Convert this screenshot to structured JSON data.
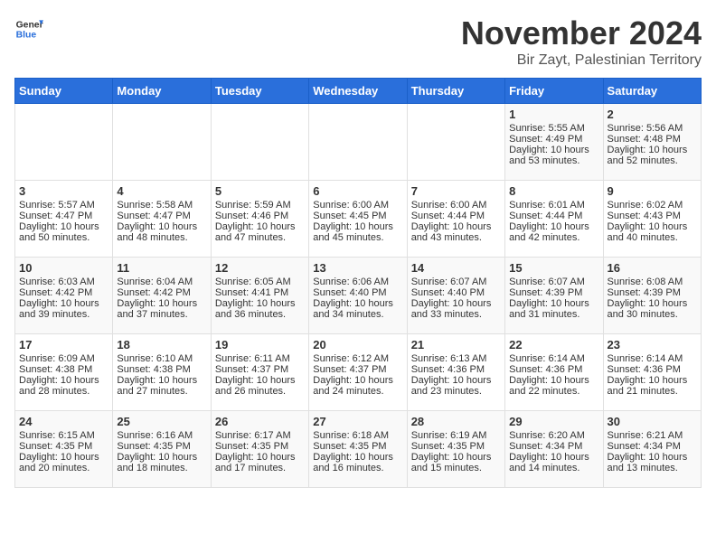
{
  "logo": {
    "general": "General",
    "blue": "Blue"
  },
  "title": "November 2024",
  "subtitle": "Bir Zayt, Palestinian Territory",
  "days_of_week": [
    "Sunday",
    "Monday",
    "Tuesday",
    "Wednesday",
    "Thursday",
    "Friday",
    "Saturday"
  ],
  "weeks": [
    [
      {
        "day": "",
        "content": ""
      },
      {
        "day": "",
        "content": ""
      },
      {
        "day": "",
        "content": ""
      },
      {
        "day": "",
        "content": ""
      },
      {
        "day": "",
        "content": ""
      },
      {
        "day": "1",
        "content": "Sunrise: 5:55 AM\nSunset: 4:49 PM\nDaylight: 10 hours and 53 minutes."
      },
      {
        "day": "2",
        "content": "Sunrise: 5:56 AM\nSunset: 4:48 PM\nDaylight: 10 hours and 52 minutes."
      }
    ],
    [
      {
        "day": "3",
        "content": "Sunrise: 5:57 AM\nSunset: 4:47 PM\nDaylight: 10 hours and 50 minutes."
      },
      {
        "day": "4",
        "content": "Sunrise: 5:58 AM\nSunset: 4:47 PM\nDaylight: 10 hours and 48 minutes."
      },
      {
        "day": "5",
        "content": "Sunrise: 5:59 AM\nSunset: 4:46 PM\nDaylight: 10 hours and 47 minutes."
      },
      {
        "day": "6",
        "content": "Sunrise: 6:00 AM\nSunset: 4:45 PM\nDaylight: 10 hours and 45 minutes."
      },
      {
        "day": "7",
        "content": "Sunrise: 6:00 AM\nSunset: 4:44 PM\nDaylight: 10 hours and 43 minutes."
      },
      {
        "day": "8",
        "content": "Sunrise: 6:01 AM\nSunset: 4:44 PM\nDaylight: 10 hours and 42 minutes."
      },
      {
        "day": "9",
        "content": "Sunrise: 6:02 AM\nSunset: 4:43 PM\nDaylight: 10 hours and 40 minutes."
      }
    ],
    [
      {
        "day": "10",
        "content": "Sunrise: 6:03 AM\nSunset: 4:42 PM\nDaylight: 10 hours and 39 minutes."
      },
      {
        "day": "11",
        "content": "Sunrise: 6:04 AM\nSunset: 4:42 PM\nDaylight: 10 hours and 37 minutes."
      },
      {
        "day": "12",
        "content": "Sunrise: 6:05 AM\nSunset: 4:41 PM\nDaylight: 10 hours and 36 minutes."
      },
      {
        "day": "13",
        "content": "Sunrise: 6:06 AM\nSunset: 4:40 PM\nDaylight: 10 hours and 34 minutes."
      },
      {
        "day": "14",
        "content": "Sunrise: 6:07 AM\nSunset: 4:40 PM\nDaylight: 10 hours and 33 minutes."
      },
      {
        "day": "15",
        "content": "Sunrise: 6:07 AM\nSunset: 4:39 PM\nDaylight: 10 hours and 31 minutes."
      },
      {
        "day": "16",
        "content": "Sunrise: 6:08 AM\nSunset: 4:39 PM\nDaylight: 10 hours and 30 minutes."
      }
    ],
    [
      {
        "day": "17",
        "content": "Sunrise: 6:09 AM\nSunset: 4:38 PM\nDaylight: 10 hours and 28 minutes."
      },
      {
        "day": "18",
        "content": "Sunrise: 6:10 AM\nSunset: 4:38 PM\nDaylight: 10 hours and 27 minutes."
      },
      {
        "day": "19",
        "content": "Sunrise: 6:11 AM\nSunset: 4:37 PM\nDaylight: 10 hours and 26 minutes."
      },
      {
        "day": "20",
        "content": "Sunrise: 6:12 AM\nSunset: 4:37 PM\nDaylight: 10 hours and 24 minutes."
      },
      {
        "day": "21",
        "content": "Sunrise: 6:13 AM\nSunset: 4:36 PM\nDaylight: 10 hours and 23 minutes."
      },
      {
        "day": "22",
        "content": "Sunrise: 6:14 AM\nSunset: 4:36 PM\nDaylight: 10 hours and 22 minutes."
      },
      {
        "day": "23",
        "content": "Sunrise: 6:14 AM\nSunset: 4:36 PM\nDaylight: 10 hours and 21 minutes."
      }
    ],
    [
      {
        "day": "24",
        "content": "Sunrise: 6:15 AM\nSunset: 4:35 PM\nDaylight: 10 hours and 20 minutes."
      },
      {
        "day": "25",
        "content": "Sunrise: 6:16 AM\nSunset: 4:35 PM\nDaylight: 10 hours and 18 minutes."
      },
      {
        "day": "26",
        "content": "Sunrise: 6:17 AM\nSunset: 4:35 PM\nDaylight: 10 hours and 17 minutes."
      },
      {
        "day": "27",
        "content": "Sunrise: 6:18 AM\nSunset: 4:35 PM\nDaylight: 10 hours and 16 minutes."
      },
      {
        "day": "28",
        "content": "Sunrise: 6:19 AM\nSunset: 4:35 PM\nDaylight: 10 hours and 15 minutes."
      },
      {
        "day": "29",
        "content": "Sunrise: 6:20 AM\nSunset: 4:34 PM\nDaylight: 10 hours and 14 minutes."
      },
      {
        "day": "30",
        "content": "Sunrise: 6:21 AM\nSunset: 4:34 PM\nDaylight: 10 hours and 13 minutes."
      }
    ]
  ]
}
